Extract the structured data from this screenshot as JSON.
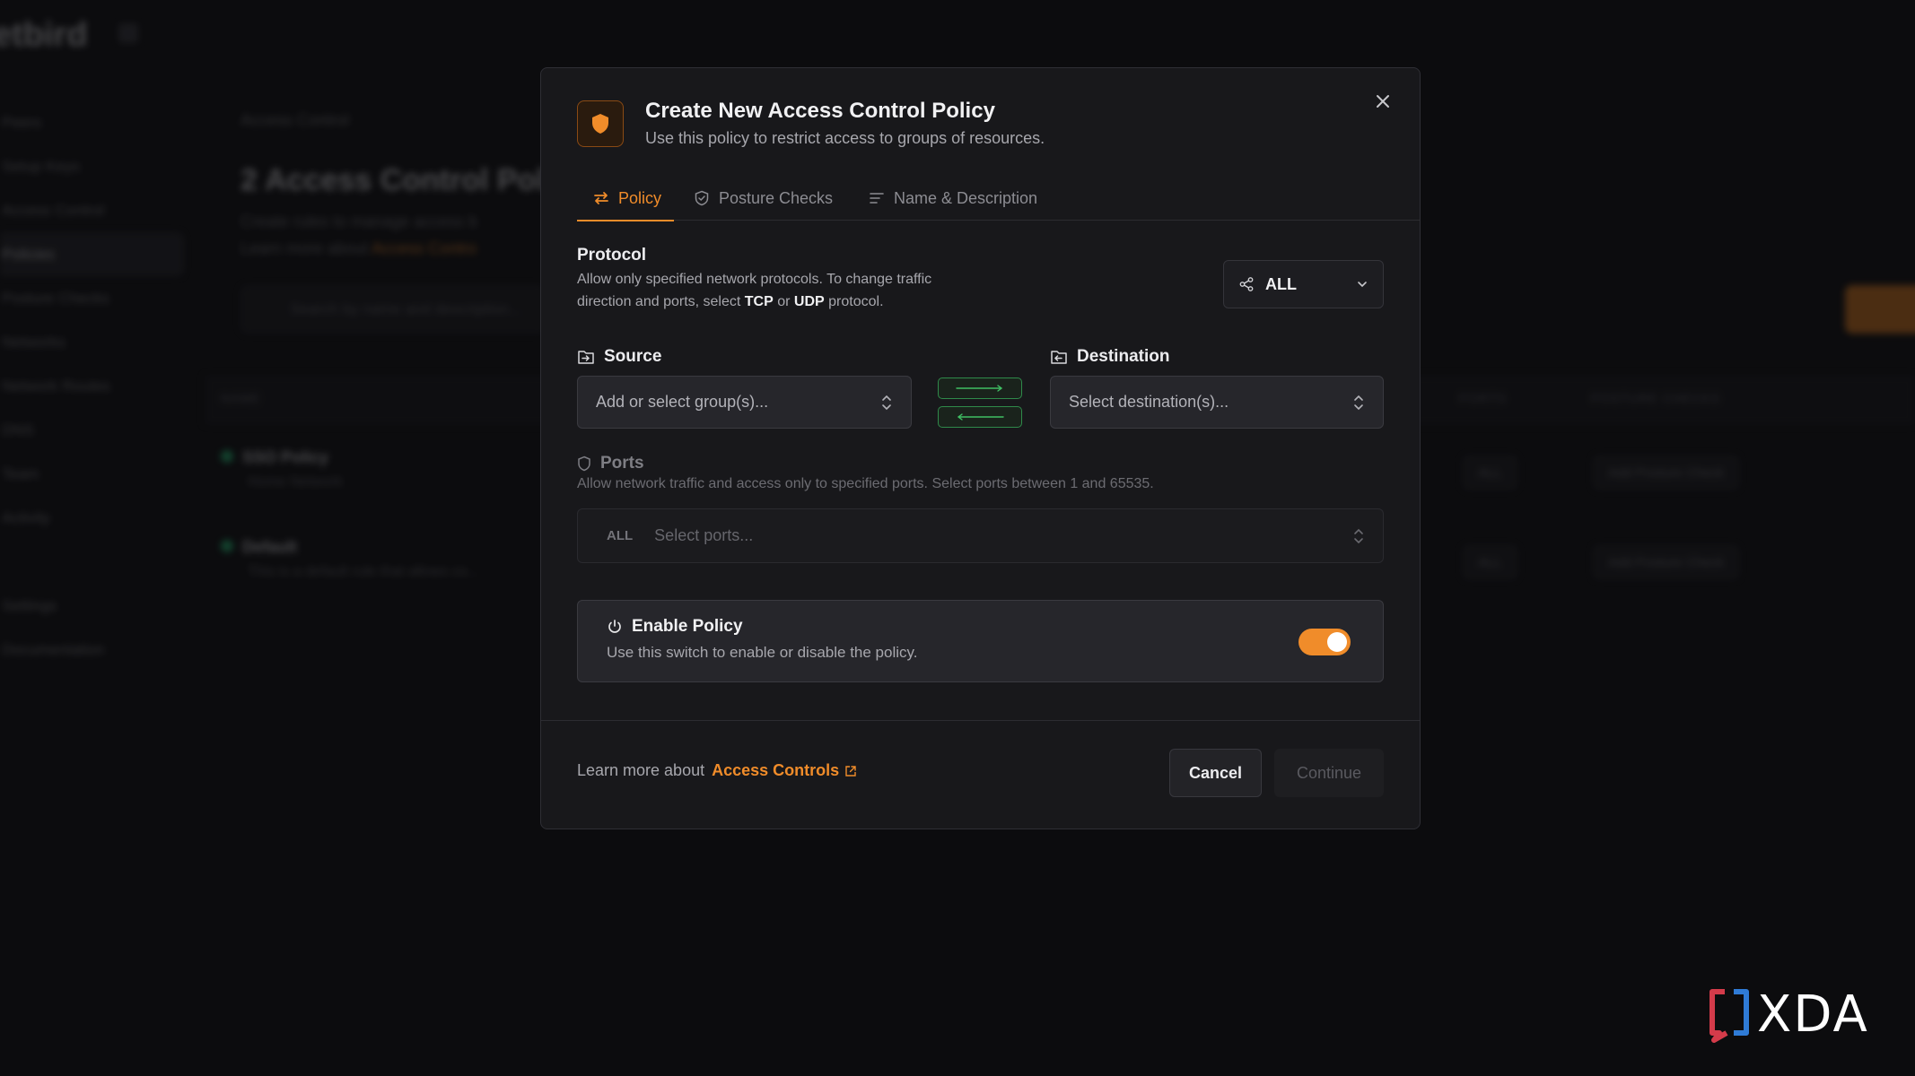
{
  "background": {
    "logo": "etbird",
    "nav": [
      "Peers",
      "Setup Keys",
      "Access Control",
      "Policies",
      "Posture Checks",
      "Networks",
      "Network Routes",
      "DNS",
      "Team",
      "Activity",
      "",
      "Settings",
      "Documentation"
    ],
    "breadcrumb": "Access Control",
    "page_title": "2 Access Control Polic",
    "description_line1": "Create rules to manage access b",
    "description_line2_prefix": "Learn more about",
    "description_line2_link": "Access Contro",
    "search_placeholder": "Search by name and description...",
    "table_columns": {
      "name": "NAME",
      "ports": "PORTS",
      "posture": "POSTURE CHECKS"
    },
    "rows": [
      {
        "name": "SSO Policy",
        "sub": "Home Network",
        "ports": "ALL",
        "posture": "Add Posture Check"
      },
      {
        "name": "Default",
        "sub": "This is a default rule that allows co...",
        "ports": "ALL",
        "posture": "Add Posture Check"
      }
    ]
  },
  "modal": {
    "title": "Create New Access Control Policy",
    "subtitle": "Use this policy to restrict access to groups of resources.",
    "tabs": [
      {
        "label": "Policy",
        "active": true
      },
      {
        "label": "Posture Checks",
        "active": false
      },
      {
        "label": "Name & Description",
        "active": false
      }
    ],
    "protocol": {
      "label": "Protocol",
      "help_prefix": "Allow only specified network protocols. To change traffic",
      "help_line2_prefix": "direction and ports, select",
      "tcp": "TCP",
      "or": "or",
      "udp": "UDP",
      "help_suffix": "protocol.",
      "selected": "ALL"
    },
    "source": {
      "label": "Source",
      "placeholder": "Add or select group(s)..."
    },
    "destination": {
      "label": "Destination",
      "placeholder": "Select destination(s)..."
    },
    "ports": {
      "label": "Ports",
      "help": "Allow network traffic and access only to specified ports. Select ports between 1 and 65535.",
      "prefix": "ALL",
      "placeholder": "Select ports..."
    },
    "enable": {
      "title": "Enable Policy",
      "subtitle": "Use this switch to enable or disable the policy.",
      "on": true
    },
    "footer": {
      "learn_prefix": "Learn more about",
      "learn_link": "Access Controls",
      "cancel": "Cancel",
      "continue": "Continue"
    }
  },
  "watermark": {
    "text": "XDA"
  },
  "colors": {
    "accent": "#f08c2a",
    "success": "#2f8a4a",
    "modal_bg": "#18181b"
  }
}
